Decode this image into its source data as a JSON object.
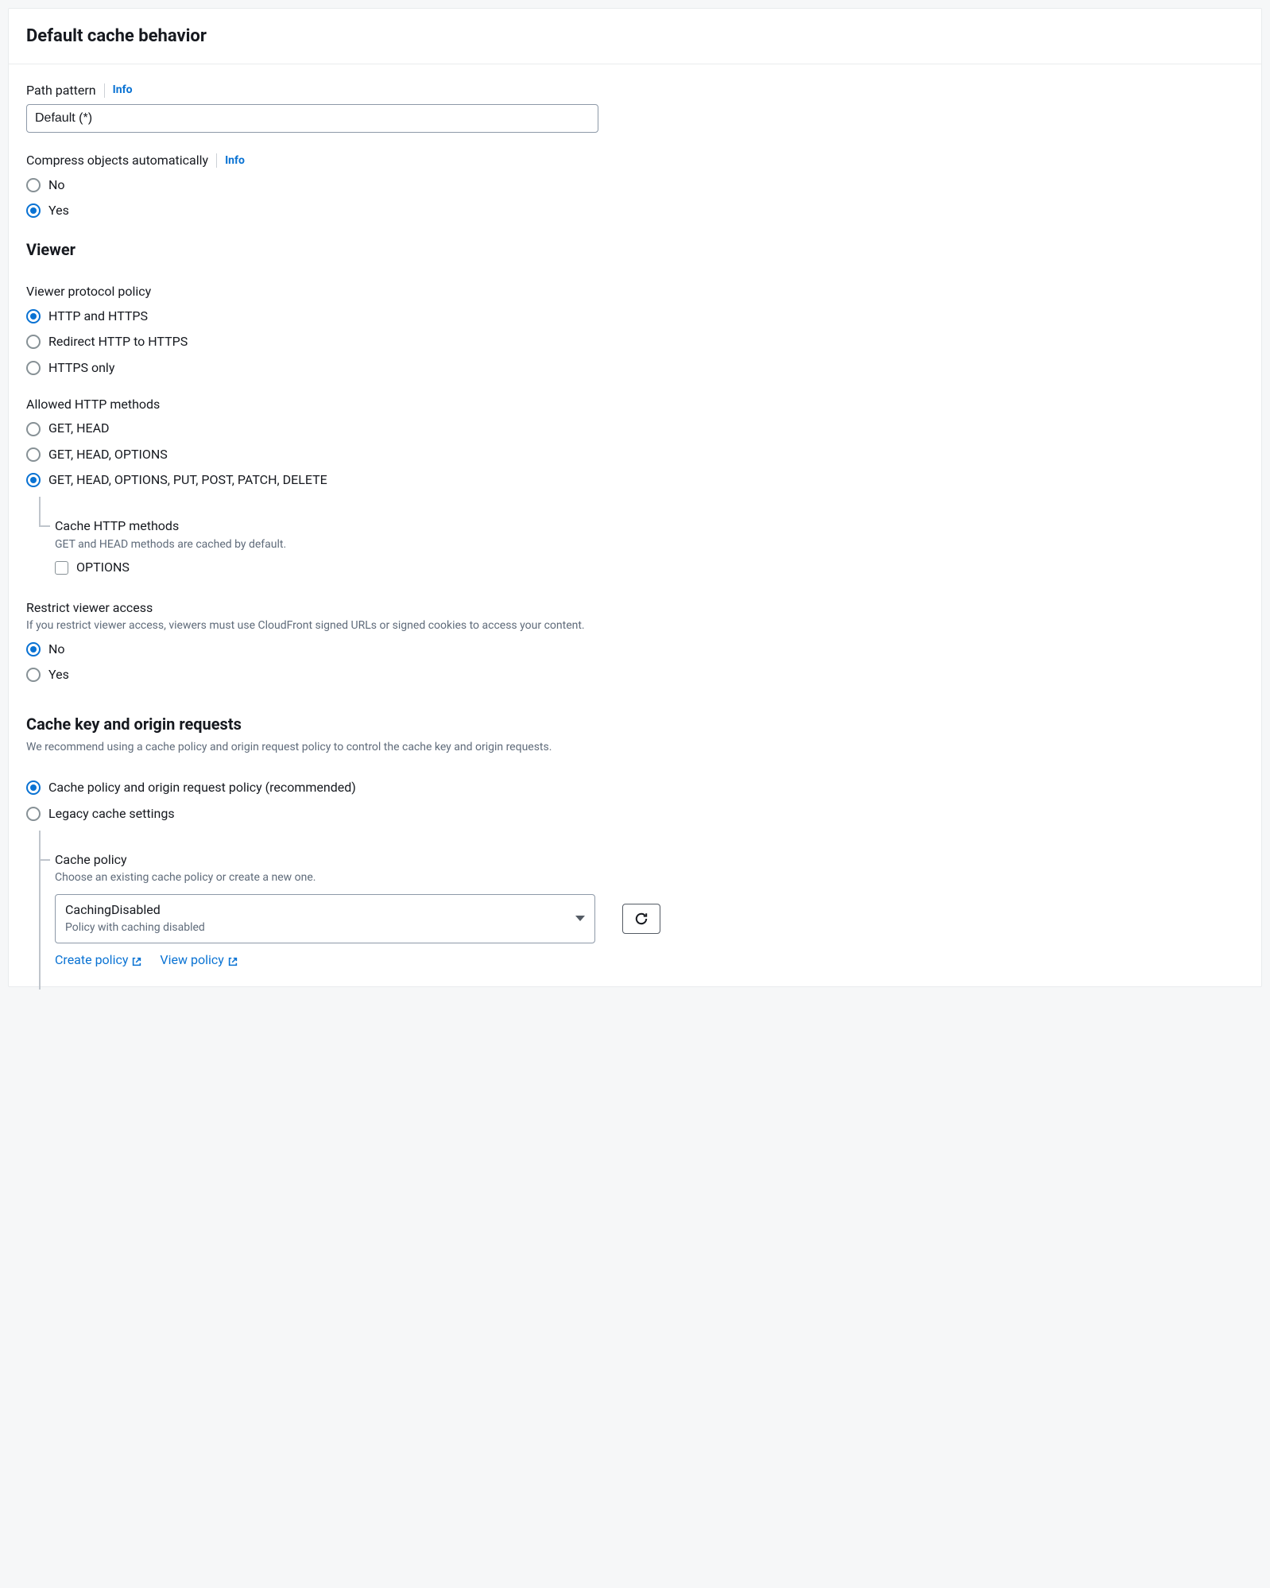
{
  "header": {
    "title": "Default cache behavior"
  },
  "pathPattern": {
    "label": "Path pattern",
    "info": "Info",
    "value": "Default (*)"
  },
  "compress": {
    "label": "Compress objects automatically",
    "info": "Info",
    "options": {
      "no": "No",
      "yes": "Yes"
    }
  },
  "viewer": {
    "heading": "Viewer",
    "protocolPolicy": {
      "label": "Viewer protocol policy",
      "options": {
        "httpAndHttps": "HTTP and HTTPS",
        "redirect": "Redirect HTTP to HTTPS",
        "httpsOnly": "HTTPS only"
      }
    },
    "allowedMethods": {
      "label": "Allowed HTTP methods",
      "options": {
        "getHead": "GET, HEAD",
        "getHeadOptions": "GET, HEAD, OPTIONS",
        "all": "GET, HEAD, OPTIONS, PUT, POST, PATCH, DELETE"
      }
    },
    "cacheMethods": {
      "label": "Cache HTTP methods",
      "desc": "GET and HEAD methods are cached by default.",
      "options": {
        "options": "OPTIONS"
      }
    },
    "restrictAccess": {
      "label": "Restrict viewer access",
      "desc": "If you restrict viewer access, viewers must use CloudFront signed URLs or signed cookies to access your content.",
      "options": {
        "no": "No",
        "yes": "Yes"
      }
    }
  },
  "cacheKey": {
    "heading": "Cache key and origin requests",
    "desc": "We recommend using a cache policy and origin request policy to control the cache key and origin requests.",
    "options": {
      "recommended": "Cache policy and origin request policy (recommended)",
      "legacy": "Legacy cache settings"
    },
    "cachePolicy": {
      "label": "Cache policy",
      "desc": "Choose an existing cache policy or create a new one.",
      "selected": {
        "name": "CachingDisabled",
        "desc": "Policy with caching disabled"
      },
      "links": {
        "create": "Create policy",
        "view": "View policy"
      }
    }
  }
}
